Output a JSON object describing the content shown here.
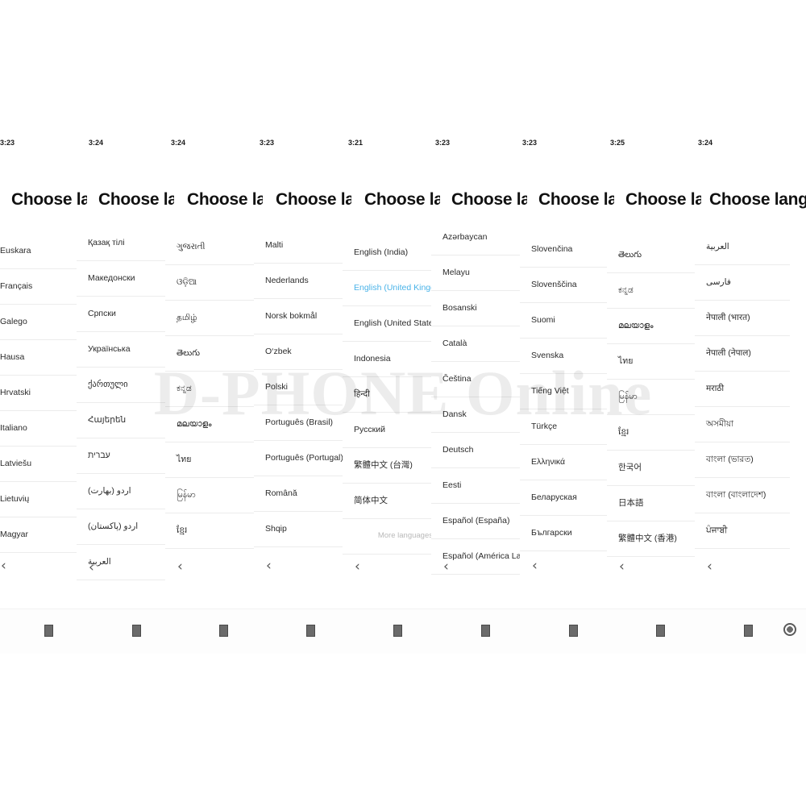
{
  "watermark": {
    "text": "D-PHONE Online"
  },
  "screens": [
    {
      "id": "screen-1",
      "clock": "3:23",
      "title": "Choose language",
      "items": [
        {
          "label": "Euskara"
        },
        {
          "label": "Français"
        },
        {
          "label": "Galego"
        },
        {
          "label": "Hausa"
        },
        {
          "label": "Hrvatski"
        },
        {
          "label": "Italiano"
        },
        {
          "label": "Latviešu"
        },
        {
          "label": "Lietuvių"
        },
        {
          "label": "Magyar"
        }
      ]
    },
    {
      "id": "screen-2",
      "clock": "3:24",
      "title": "Choose language",
      "items": [
        {
          "label": "Қазақ тілі"
        },
        {
          "label": "Македонски"
        },
        {
          "label": "Српски"
        },
        {
          "label": "Українська"
        },
        {
          "label": "ქართული"
        },
        {
          "label": "Հայերեն"
        },
        {
          "label": "עברית",
          "rtl": true
        },
        {
          "label": "اردو (بھارت)",
          "rtl": true
        },
        {
          "label": "اردو (پاکستان)",
          "rtl": true
        },
        {
          "label": "العربية",
          "rtl": true
        }
      ]
    },
    {
      "id": "screen-3",
      "clock": "3:24",
      "title": "Choose language",
      "items": [
        {
          "label": "ગુજરાતી"
        },
        {
          "label": "ଓଡ଼ିଆ"
        },
        {
          "label": "தமிழ்"
        },
        {
          "label": "తెలుగు"
        },
        {
          "label": "ಕನ್ನಡ"
        },
        {
          "label": "മലയാളം"
        },
        {
          "label": "ไทย"
        },
        {
          "label": "မြန်မာ"
        },
        {
          "label": "ខ្មែរ"
        }
      ]
    },
    {
      "id": "screen-4",
      "clock": "3:23",
      "title": "Choose language",
      "items": [
        {
          "label": "Malti"
        },
        {
          "label": "Nederlands"
        },
        {
          "label": "Norsk bokmål"
        },
        {
          "label": "O‘zbek"
        },
        {
          "label": "Polski"
        },
        {
          "label": "Português (Brasil)"
        },
        {
          "label": "Português (Portugal)"
        },
        {
          "label": "Română"
        },
        {
          "label": "Shqip"
        }
      ]
    },
    {
      "id": "screen-5",
      "clock": "3:21",
      "title": "Choose language",
      "items": [
        {
          "label": "English (India)"
        },
        {
          "label": "English (United Kingdom)",
          "selected": true
        },
        {
          "label": "English (United States)"
        },
        {
          "label": "Indonesia"
        },
        {
          "label": "हिन्दी"
        },
        {
          "label": "Русский"
        },
        {
          "label": "繁體中文 (台灣)"
        },
        {
          "label": "简体中文"
        },
        {
          "label": "More languages",
          "more": true
        }
      ]
    },
    {
      "id": "screen-6",
      "clock": "3:23",
      "title": "Choose language",
      "items": [
        {
          "label": "Azərbaycan"
        },
        {
          "label": "Melayu"
        },
        {
          "label": "Bosanski"
        },
        {
          "label": "Català"
        },
        {
          "label": "Čeština"
        },
        {
          "label": "Dansk"
        },
        {
          "label": "Deutsch"
        },
        {
          "label": "Eesti"
        },
        {
          "label": "Español (España)"
        },
        {
          "label": "Español (América Latina)"
        }
      ]
    },
    {
      "id": "screen-7",
      "clock": "3:23",
      "title": "Choose language",
      "items": [
        {
          "label": "Slovenčina"
        },
        {
          "label": "Slovenščina"
        },
        {
          "label": "Suomi"
        },
        {
          "label": "Svenska"
        },
        {
          "label": "Tiếng Việt"
        },
        {
          "label": "Türkçe"
        },
        {
          "label": "Ελληνικά"
        },
        {
          "label": "Беларуская"
        },
        {
          "label": "Български"
        }
      ]
    },
    {
      "id": "screen-8",
      "clock": "3:25",
      "title": "Choose language",
      "items": [
        {
          "label": "తెలుగు"
        },
        {
          "label": "ಕನ್ನಡ"
        },
        {
          "label": "മലയാളം"
        },
        {
          "label": "ไทย"
        },
        {
          "label": "မြန်မာ"
        },
        {
          "label": "ខ្មែរ"
        },
        {
          "label": "한국어"
        },
        {
          "label": "日本語"
        },
        {
          "label": "繁體中文 (香港)"
        }
      ]
    },
    {
      "id": "screen-9",
      "clock": "3:24",
      "title": "Choose language",
      "items": [
        {
          "label": "العربية",
          "rtl": true
        },
        {
          "label": "فارسی",
          "rtl": true
        },
        {
          "label": "नेपाली (भारत)"
        },
        {
          "label": "नेपाली (नेपाल)"
        },
        {
          "label": "मराठी"
        },
        {
          "label": "অসমীয়া"
        },
        {
          "label": "বাংলা (ভারত)"
        },
        {
          "label": "বাংলা (বাংলাদেশ)"
        },
        {
          "label": "ਪੰਜਾਬੀ"
        }
      ]
    }
  ],
  "nav": {
    "back_icon": "chevron-left-icon",
    "square_icon": "square-nav-indicator",
    "circle_icon": "circle-nav-indicator"
  },
  "colors": {
    "selected": "#4ab3e8",
    "text": "#2b2b2b",
    "title": "#111111",
    "divider": "#ececec",
    "muted": "#b9b9b9"
  }
}
